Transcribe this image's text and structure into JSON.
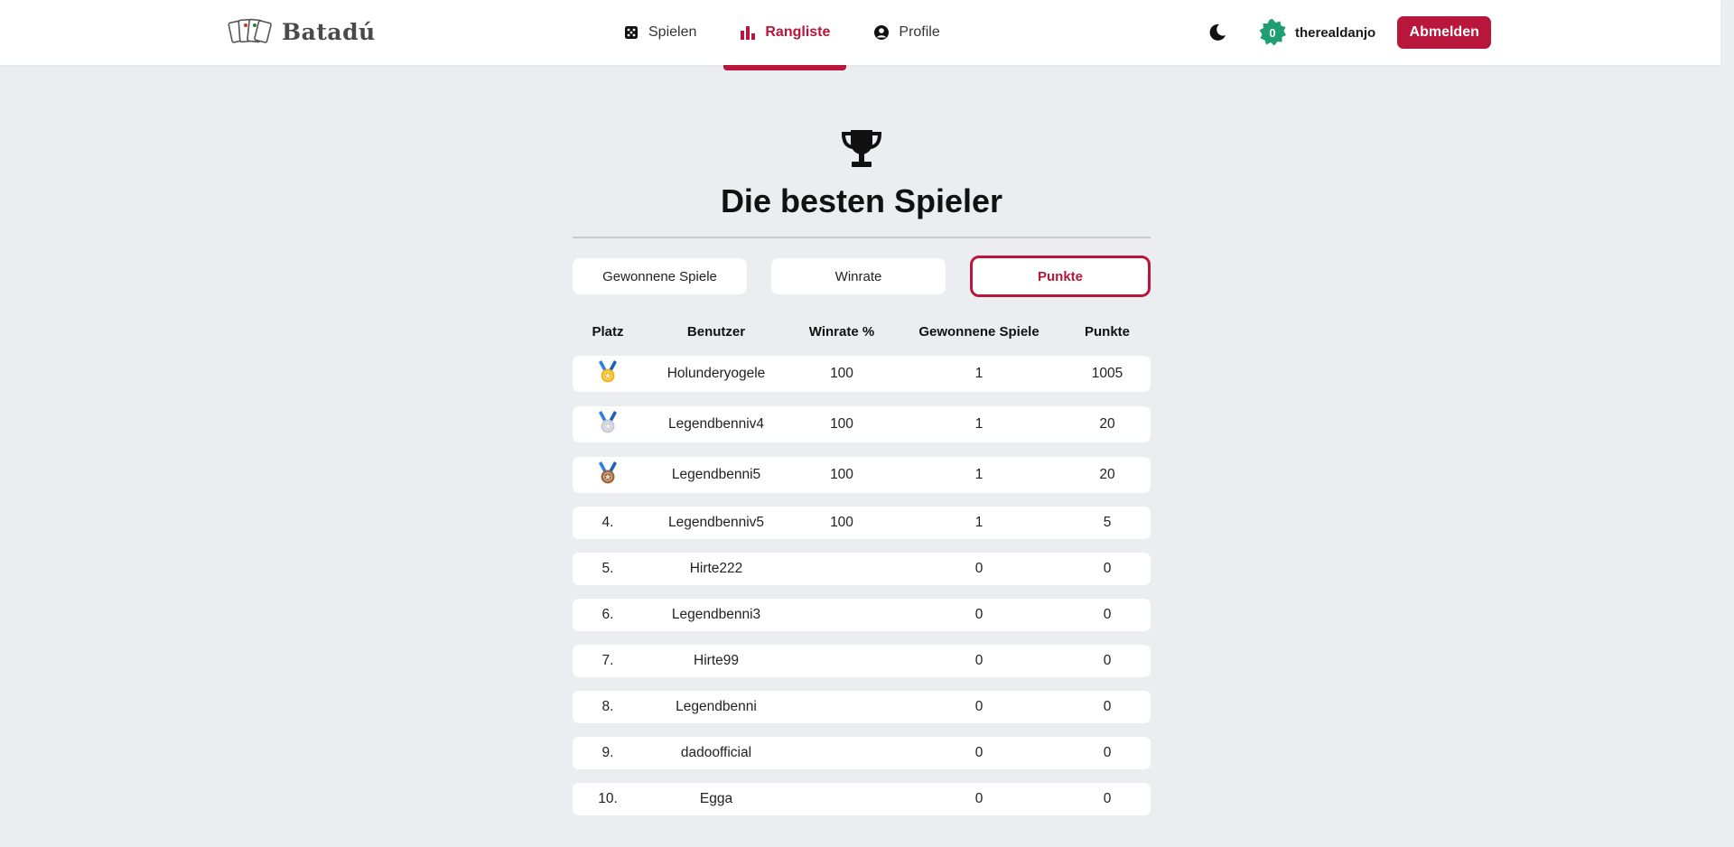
{
  "app": {
    "name": "Batadú"
  },
  "nav": [
    {
      "label": "Spielen",
      "icon": "dice-icon",
      "active": false
    },
    {
      "label": "Rangliste",
      "icon": "bar-chart-icon",
      "active": true
    },
    {
      "label": "Profile",
      "icon": "user-circle-icon",
      "active": false
    }
  ],
  "user": {
    "level": "0",
    "name": "therealdanjo",
    "logout_label": "Abmelden"
  },
  "page": {
    "title": "Die besten Spieler"
  },
  "tabs": [
    {
      "label": "Gewonnene Spiele",
      "active": false
    },
    {
      "label": "Winrate",
      "active": false
    },
    {
      "label": "Punkte",
      "active": true
    }
  ],
  "table": {
    "headers": [
      "Platz",
      "Benutzer",
      "Winrate %",
      "Gewonnene Spiele",
      "Punkte"
    ],
    "rows": [
      {
        "rank": "",
        "medal": "gold",
        "user": "Holunderyogele",
        "winrate": "100",
        "won": "1",
        "points": "1005"
      },
      {
        "rank": "",
        "medal": "silver",
        "user": "Legendbenniv4",
        "winrate": "100",
        "won": "1",
        "points": "20"
      },
      {
        "rank": "",
        "medal": "bronze",
        "user": "Legendbenni5",
        "winrate": "100",
        "won": "1",
        "points": "20"
      },
      {
        "rank": "4.",
        "medal": "",
        "user": "Legendbenniv5",
        "winrate": "100",
        "won": "1",
        "points": "5"
      },
      {
        "rank": "5.",
        "medal": "",
        "user": "Hirte222",
        "winrate": "",
        "won": "0",
        "points": "0"
      },
      {
        "rank": "6.",
        "medal": "",
        "user": "Legendbenni3",
        "winrate": "",
        "won": "0",
        "points": "0"
      },
      {
        "rank": "7.",
        "medal": "",
        "user": "Hirte99",
        "winrate": "",
        "won": "0",
        "points": "0"
      },
      {
        "rank": "8.",
        "medal": "",
        "user": "Legendbenni",
        "winrate": "",
        "won": "0",
        "points": "0"
      },
      {
        "rank": "9.",
        "medal": "",
        "user": "dadoofficial",
        "winrate": "",
        "won": "0",
        "points": "0"
      },
      {
        "rank": "10.",
        "medal": "",
        "user": "Egga",
        "winrate": "",
        "won": "0",
        "points": "0"
      }
    ]
  },
  "colors": {
    "accent": "#b8163a",
    "background": "#ecedf1",
    "badge": "#1f9e73"
  }
}
